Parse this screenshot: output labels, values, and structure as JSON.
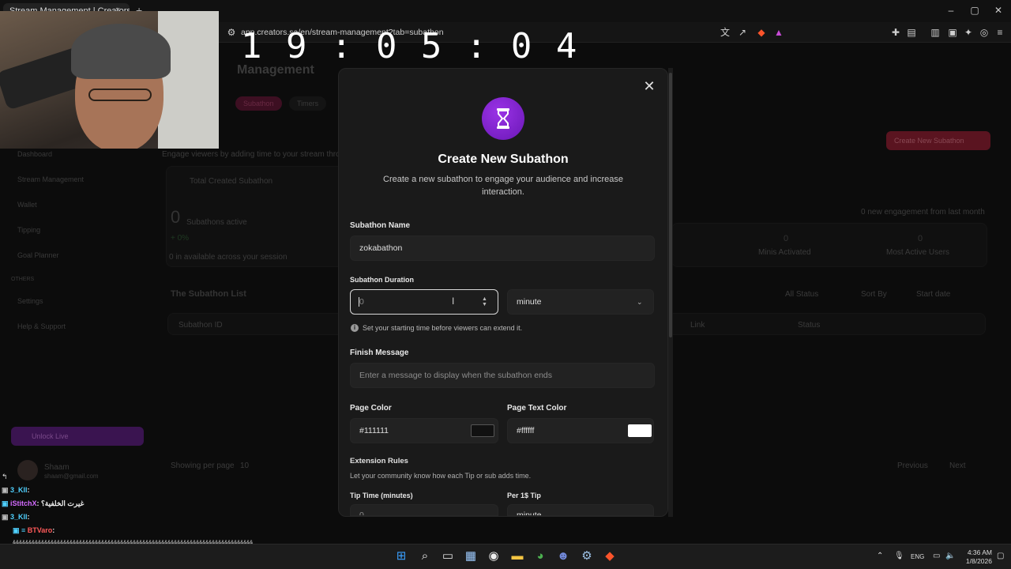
{
  "browser": {
    "tab_title": "Stream Management | Creators",
    "tab_close": "×",
    "new_tab": "+",
    "url": "app.creators.sa/en/stream-management?tab=subathon",
    "window_controls": [
      "–",
      "▢",
      "✕"
    ]
  },
  "overlay": {
    "clock": "19:05:04"
  },
  "background_page": {
    "title": "Management",
    "tabs": [
      "Subathon",
      "Timers"
    ],
    "create_button": "Create New Subathon",
    "description": "Engage viewers by adding time to your stream through...",
    "stat_label": "Total Created Subathon",
    "stat_value": "0",
    "stat_sub": "Subathons active",
    "stat_delta": "+ 0%",
    "stat_note": "0 in available across your session",
    "stat_columns": [
      "0",
      "0"
    ],
    "stat_col_labels": [
      "Minis Activated",
      "Most Active Users"
    ],
    "engagement_note": "0 new engagement from last month",
    "list_title": "The Subathon List",
    "table_headers": [
      "Subathon ID",
      "Link",
      "Status"
    ],
    "filters": [
      "All Status",
      "Sort By",
      "Start date"
    ],
    "rows_per_page": "Showing per page",
    "rows_count": "10",
    "pagination": [
      "Previous",
      "Next"
    ],
    "sidebar": [
      "Dashboard",
      "Stream Management",
      "Wallet",
      "Tipping",
      "Goal Planner"
    ],
    "sidebar_section": "OTHERS",
    "sidebar_others": [
      "Settings",
      "Help & Support"
    ],
    "tip_button": "Unlock Live",
    "user_name": "Shaam",
    "user_email": "shaam@gmail.com"
  },
  "modal": {
    "close_icon": "close-icon",
    "hero_icon": "hourglass-icon",
    "hero_color": "#7b22c9",
    "title": "Create New Subathon",
    "subtitle": "Create a new subathon to engage your audience and increase interaction.",
    "name_label": "Subathon Name",
    "name_value": "zokabathon",
    "duration_label": "Subathon Duration",
    "duration_value": "0",
    "duration_unit": "minute",
    "duration_hint": "Set your starting time before viewers can extend it.",
    "finish_label": "Finish Message",
    "finish_placeholder": "Enter a message to display when the subathon ends",
    "page_color_label": "Page Color",
    "page_color_value": "#111111",
    "page_text_color_label": "Page Text Color",
    "page_text_color_value": "#ffffff",
    "extension_title": "Extension Rules",
    "extension_desc": "Let your community know how each Tip or sub adds time.",
    "tip_time_label": "Tip Time (minutes)",
    "tip_time_value": "0",
    "per_tip_label": "Per 1$ Tip",
    "per_tip_value": "minute"
  },
  "chat": [
    {
      "user": "3_Kll",
      "text": ":",
      "color": "#4fd1ff"
    },
    {
      "user": "iStitchX",
      "text": ": غيرت الخلفية؟",
      "color": "#d46bff"
    },
    {
      "user": "3_Kll",
      "text": ":",
      "color": "#4fd1ff"
    },
    {
      "user": "BTVaro",
      "text": ":",
      "color": "#ff5a5a"
    }
  ],
  "chat_hash": "&&&&&&&&&&&&&&&&&&&&&&&&&&&&&&&&&&&&&&&&&&&&&&&&&&&&&&&&&&&&&&&&&&&&&&&&&&&&",
  "taskbar": {
    "apps": [
      "windows-start-icon",
      "search-icon",
      "task-view-icon",
      "store-icon",
      "obs-icon",
      "file-explorer-icon",
      "chrome-icon",
      "discord-icon",
      "steam-icon",
      "brave-icon"
    ],
    "language": "ENG",
    "time": "4:36 AM",
    "date": "1/8/2026"
  }
}
